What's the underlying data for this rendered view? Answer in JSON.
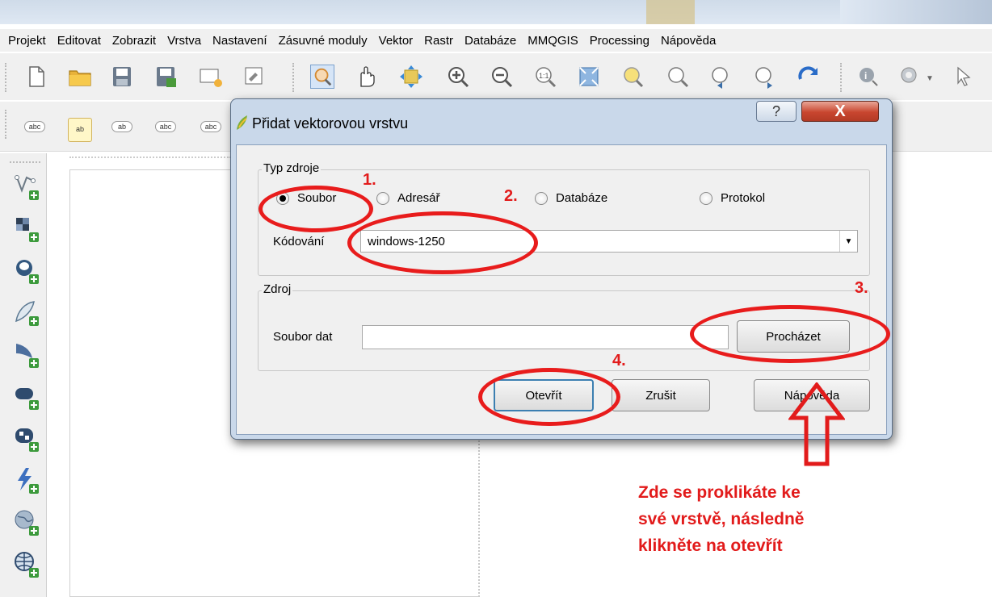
{
  "menu": [
    "Projekt",
    "Editovat",
    "Zobrazit",
    "Vrstva",
    "Nastavení",
    "Zásuvné moduly",
    "Vektor",
    "Rastr",
    "Databáze",
    "MMQGIS",
    "Processing",
    "Nápověda"
  ],
  "label_toolbar": [
    "abc",
    "ab",
    "ab",
    "abc",
    "abc"
  ],
  "toolbar_icons": [
    "new-project-icon",
    "open-project-icon",
    "save-project-icon",
    "save-as-icon",
    "new-print-composer-icon",
    "composer-manager-icon",
    "pan-map-to-selection-icon",
    "pan-icon",
    "move-icon",
    "zoom-in-icon",
    "zoom-out-icon",
    "zoom-actual-icon",
    "zoom-full-icon",
    "zoom-to-selection-icon",
    "zoom-to-layer-icon",
    "zoom-last-icon",
    "zoom-next-icon",
    "refresh-icon",
    "identify-icon",
    "settings-icon"
  ],
  "left_toolbar_icons": [
    "add-vector-layer-icon",
    "add-raster-layer-icon",
    "add-postgis-layer-icon",
    "add-spatialite-layer-icon",
    "add-mssql-layer-icon",
    "add-oracle-layer-icon",
    "add-db2-layer-icon",
    "add-wms-layer-icon",
    "add-wcs-layer-icon",
    "add-wfs-layer-icon"
  ],
  "dialog": {
    "title": "Přidat vektorovou vrstvu",
    "help_label": "?",
    "close_label": "X",
    "source_type_group": "Typ zdroje",
    "radio_file": "Soubor",
    "radio_directory": "Adresář",
    "radio_database": "Databáze",
    "radio_protocol": "Protokol",
    "encoding_label": "Kódování",
    "encoding_value": "windows-1250",
    "source_group": "Zdroj",
    "dataset_label": "Soubor dat",
    "dataset_value": "",
    "browse_label": "Procházet",
    "open_label": "Otevřít",
    "cancel_label": "Zrušit",
    "help_button_label": "Nápověda"
  },
  "annotations": {
    "step1": "1.",
    "step2": "2.",
    "step3": "3.",
    "step4": "4.",
    "note_line1": "Zde se proklikáte ke",
    "note_line2": "své vrstvě, následně",
    "note_line3": "klikněte na otevřít",
    "color": "#e21b1b"
  }
}
